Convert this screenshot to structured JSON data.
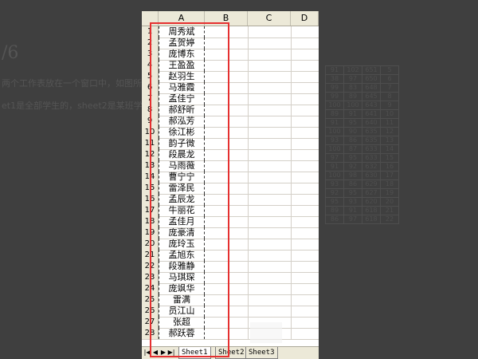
{
  "background_article": {
    "step": "/6",
    "lines": [
      "两个工作表放在一个窗口中，如图所示：",
      "et1是全部学生的，sheet2是某班学生花"
    ],
    "table_rows": [
      [
        "91",
        "102",
        "651",
        "5"
      ],
      [
        "38",
        "97",
        "650",
        "6"
      ],
      [
        "99",
        "83",
        "648",
        "7"
      ],
      [
        "99",
        "89",
        "645",
        "8"
      ],
      [
        "100",
        "100",
        "643",
        "9"
      ],
      [
        "89",
        "91",
        "641",
        "10"
      ],
      [
        "91",
        "95",
        "640",
        "11"
      ],
      [
        "100",
        "90",
        "635",
        "12"
      ],
      [
        "93",
        "86",
        "635",
        "13"
      ],
      [
        "100",
        "87",
        "633",
        "14"
      ],
      [
        "97",
        "95",
        "633",
        "15"
      ],
      [
        "91",
        "92",
        "632",
        "16"
      ],
      [
        "100",
        "98",
        "630",
        "17"
      ],
      [
        "93",
        "86",
        "629",
        "18"
      ],
      [
        "92",
        "95",
        "627",
        "19"
      ],
      [
        "95",
        "93",
        "620",
        "20"
      ],
      [
        "89",
        "91",
        "618",
        "21"
      ],
      [
        "86",
        "97",
        "618",
        "22"
      ]
    ]
  },
  "spreadsheet": {
    "columns": [
      "A",
      "B",
      "C",
      "D"
    ],
    "rows": [
      {
        "num": "1",
        "name": "周秀斌"
      },
      {
        "num": "2",
        "name": "孟贺婷"
      },
      {
        "num": "3",
        "name": "庞博东"
      },
      {
        "num": "4",
        "name": "王盈盈"
      },
      {
        "num": "5",
        "name": "赵羽生"
      },
      {
        "num": "6",
        "name": "马雅霞"
      },
      {
        "num": "7",
        "name": "孟佳宁"
      },
      {
        "num": "8",
        "name": "郝舒昕"
      },
      {
        "num": "9",
        "name": "郝泓芳"
      },
      {
        "num": "10",
        "name": "徐江彬"
      },
      {
        "num": "11",
        "name": "韵子微"
      },
      {
        "num": "12",
        "name": "段晨龙"
      },
      {
        "num": "13",
        "name": "马雨薇"
      },
      {
        "num": "14",
        "name": "曹宁宁"
      },
      {
        "num": "15",
        "name": "雷泽民"
      },
      {
        "num": "16",
        "name": "孟辰龙"
      },
      {
        "num": "17",
        "name": "牛丽花"
      },
      {
        "num": "18",
        "name": "孟佳月"
      },
      {
        "num": "19",
        "name": "庞豪清"
      },
      {
        "num": "20",
        "name": "庞玲玉"
      },
      {
        "num": "21",
        "name": "孟旭东"
      },
      {
        "num": "22",
        "name": "段雅静"
      },
      {
        "num": "23",
        "name": "马琪琛"
      },
      {
        "num": "24",
        "name": "庞飒华"
      },
      {
        "num": "25",
        "name": "雷满"
      },
      {
        "num": "26",
        "name": "员江山"
      },
      {
        "num": "27",
        "name": "张超"
      },
      {
        "num": "28",
        "name": "郝跃蓉"
      }
    ],
    "sheet_tabs": [
      "Sheet1",
      "Sheet2",
      "Sheet3"
    ],
    "active_tab": "Sheet1",
    "nav_icons": [
      "first-sheet-icon",
      "prev-sheet-icon",
      "next-sheet-icon",
      "last-sheet-icon"
    ],
    "nav_glyphs": [
      "|◀",
      "◀",
      "▶",
      "▶|"
    ]
  },
  "colors": {
    "highlight": "#e53030",
    "header_bg": "#ece9d8",
    "backdrop": "#3f3f3f"
  }
}
